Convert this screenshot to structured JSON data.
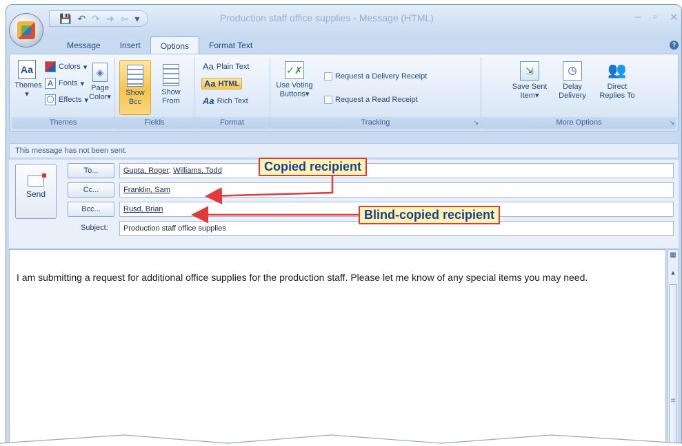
{
  "window": {
    "title": "Production staff office supplies - Message (HTML)",
    "quick_access": [
      "💾",
      "↶",
      "↷",
      "→",
      "←",
      "▾"
    ]
  },
  "tabs": [
    "Message",
    "Insert",
    "Options",
    "Format Text"
  ],
  "ribbon": {
    "groups": {
      "themes": "Themes",
      "fields": "Fields",
      "format": "Format",
      "tracking": "Tracking",
      "more_options": "More Options"
    },
    "themes_label": "Themes",
    "colors": "Colors",
    "fonts": "Fonts",
    "effects": "Effects",
    "page_color": "Page Color",
    "show_bcc": "Show Bcc",
    "show_from": "Show From",
    "plain_text": "Plain Text",
    "html": "HTML",
    "rich_text": "Rich Text",
    "use_voting": "Use Voting Buttons",
    "delivery_receipt": "Request a Delivery Receipt",
    "read_receipt": "Request a Read Receipt",
    "save_sent": "Save Sent Item",
    "delay_delivery": "Delay Delivery",
    "direct_replies": "Direct Replies To"
  },
  "infobar": "This message has not been sent.",
  "header": {
    "send": "Send",
    "to_btn": "To...",
    "cc_btn": "Cc...",
    "bcc_btn": "Bcc...",
    "subject_label": "Subject:",
    "to_1": "Gupta, Roger",
    "to_2": "Williams, Todd",
    "cc": "Franklin, Sam",
    "bcc": "Rusd, Brian",
    "subject": "Production staff office supplies"
  },
  "body": "I am submitting a request for additional office supplies for the production staff. Please let me know of any special items you may need.",
  "callouts": {
    "copied": "Copied recipient",
    "blind": "Blind-copied recipient"
  }
}
